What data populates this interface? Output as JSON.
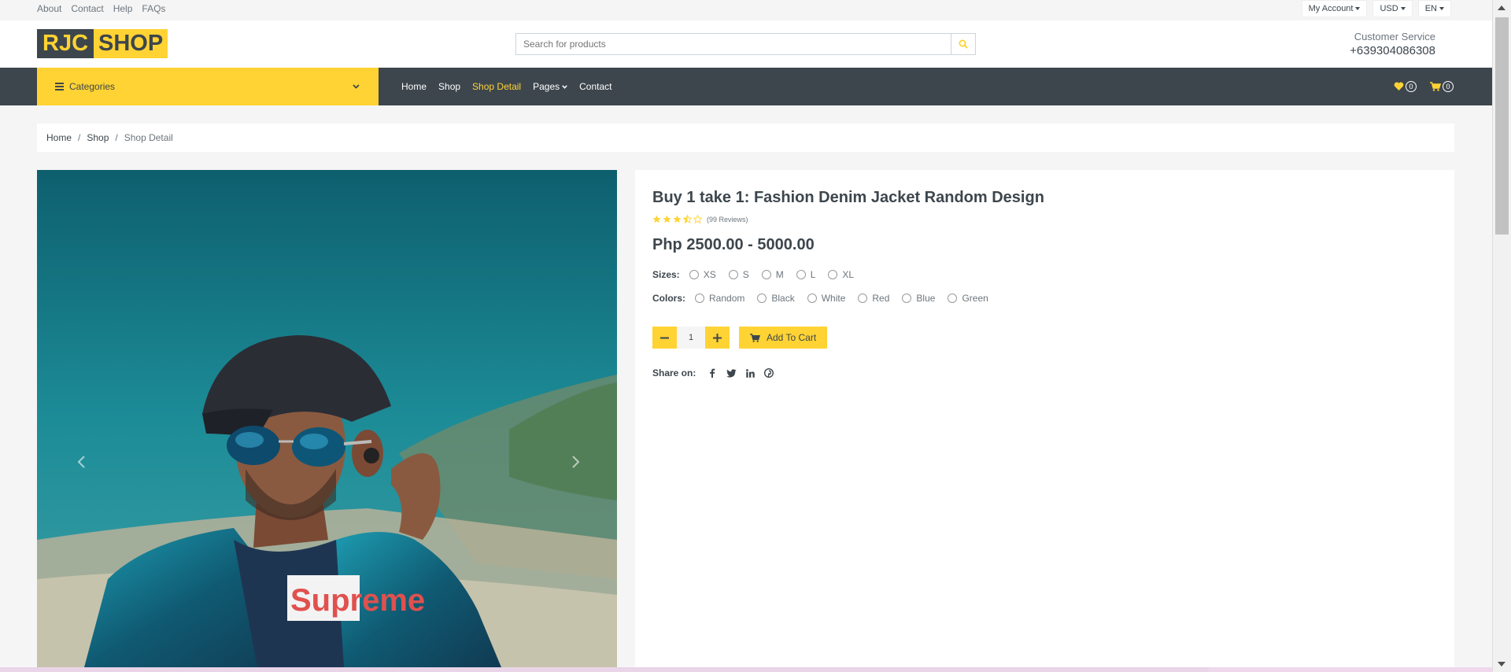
{
  "topbar": {
    "links": [
      "About",
      "Contact",
      "Help",
      "FAQs"
    ],
    "my_account": "My Account",
    "currency": "USD",
    "language": "EN"
  },
  "header": {
    "logo_part1": "RJC",
    "logo_part2": "SHOP",
    "search_placeholder": "Search for products",
    "customer_service_label": "Customer Service",
    "phone": "+639304086308"
  },
  "nav": {
    "categories_label": "Categories",
    "links": [
      "Home",
      "Shop",
      "Shop Detail",
      "Pages",
      "Contact"
    ],
    "active": "Shop Detail",
    "wishlist_count": "0",
    "cart_count": "0"
  },
  "breadcrumb": [
    "Home",
    "Shop",
    "Shop Detail"
  ],
  "product": {
    "title": "Buy 1 take 1: Fashion Denim Jacket Random Design",
    "rating_stars": 3.5,
    "reviews": "(99 Reviews)",
    "price": "Php 2500.00 - 5000.00",
    "sizes_label": "Sizes:",
    "sizes": [
      "XS",
      "S",
      "M",
      "L",
      "XL"
    ],
    "colors_label": "Colors:",
    "colors": [
      "Random",
      "Black",
      "White",
      "Red",
      "Blue",
      "Green"
    ],
    "quantity": "1",
    "add_to_cart": "Add To Cart",
    "share_label": "Share on:",
    "photo_shirt_text": "Supreme"
  },
  "colors": {
    "accent": "#FFD333",
    "dark": "#3D464D"
  }
}
